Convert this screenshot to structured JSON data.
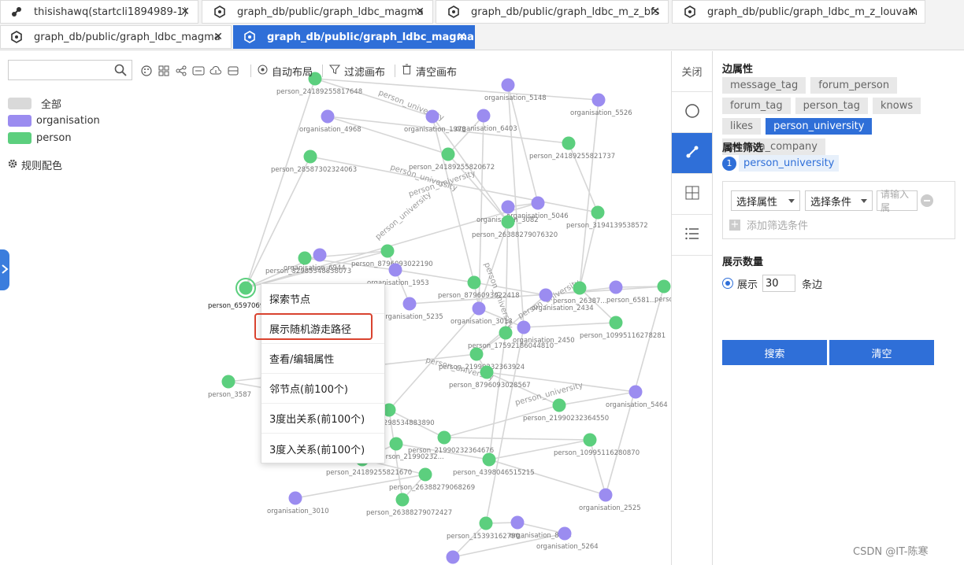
{
  "tabs": [
    {
      "label": "thisishawq(startcli1894989-1)",
      "icon": "graph-app-icon",
      "active": false
    },
    {
      "label": "graph_db/public/graph_ldbc_magma",
      "icon": "graph-hex-icon",
      "active": false
    },
    {
      "label": "graph_db/public/graph_ldbc_m_z_bfs",
      "icon": "graph-hex-icon",
      "active": false
    },
    {
      "label": "graph_db/public/graph_ldbc_m_z_louvain",
      "icon": "graph-hex-icon",
      "active": false
    },
    {
      "label": "graph_db/public/graph_ldbc_magma",
      "icon": "graph-hex-icon",
      "active": false
    },
    {
      "label": "graph_db/public/graph_ldbc_magma",
      "icon": "graph-hex-icon",
      "active": true
    }
  ],
  "toolbar": {
    "auto_layout": "自动布局",
    "filter_canvas": "过滤画布",
    "clear_canvas": "清空画布"
  },
  "legend": {
    "items": [
      {
        "label": "全部",
        "color": "#d9d9d9"
      },
      {
        "label": "organisation",
        "color": "#9b8cf0"
      },
      {
        "label": "person",
        "color": "#5ccf7e"
      }
    ],
    "rule_color": "规则配色"
  },
  "colors": {
    "accent": "#2f6fd8",
    "organisation": "#9b8cf0",
    "person": "#5ccf7e",
    "edge": "#d6d6d6"
  },
  "context_menu": {
    "items": [
      "探索节点",
      "展示随机游走路径",
      "查看/编辑属性",
      "邻节点(前100个)",
      "3度出关系(前100个)",
      "3度入关系(前100个)"
    ],
    "highlighted": "展示随机游走路径"
  },
  "graph": {
    "node_labels": [
      "person_24189255817648",
      "organisation_4968",
      "organisation_1978",
      "organisation_6403",
      "organisation_5148",
      "organisation_5526",
      "person_28587302324063",
      "person_24189255820672",
      "person_24189255821737",
      "organisation_5046",
      "organisation_3082",
      "person_26388279076320",
      "person_3194139538572",
      "person_8796093022190",
      "person_32985348838073",
      "organisation_6944",
      "organisation_1953",
      "person_6597069...",
      "person_8796093022418",
      "organisation_5235",
      "organisation_3013",
      "person_26387...",
      "organisation_2434",
      "person_6581...",
      "person_8796...",
      "person_10995116278281",
      "organisation_2450",
      "person_17592186044810",
      "person_21990232363924",
      "person_8796093028567",
      "person_3587",
      "organisation_5464",
      "person_21990232364550",
      "person_3298534883890",
      "person_21990232364676",
      "person_10995116280870",
      "person_4398046515215",
      "person_21990232...",
      "person_24189255821670",
      "person_26388279068269",
      "organisation_3010",
      "person_26388279072427",
      "organisation_2525",
      "person_15393162790...",
      "organisation_8474",
      "organisation_5264",
      "organis..."
    ],
    "edge_labels": [
      "person_university",
      "person_university",
      "person_university",
      "person_university",
      "person_university",
      "person_university",
      "person_university",
      "person_university"
    ]
  },
  "right_tabs": {
    "close": "关闭"
  },
  "panel": {
    "edge_props_title": "边属性",
    "tags": [
      "message_tag",
      "forum_person",
      "forum_tag",
      "person_tag",
      "knows",
      "likes",
      "person_university",
      "person_company"
    ],
    "active_tag": "person_university",
    "filter_title": "属性筛选",
    "filter_chip_num": "1",
    "filter_chip": "person_university",
    "select_attr": "选择属性",
    "select_cond": "选择条件",
    "input_placeholder": "请输入属",
    "add_filter": "添加筛选条件",
    "show_count_title": "展示数量",
    "show_label": "展示",
    "show_value": "30",
    "edges_unit": "条边",
    "search_btn": "搜索",
    "clear_btn": "清空"
  },
  "watermark": "CSDN @IT-陈寒"
}
